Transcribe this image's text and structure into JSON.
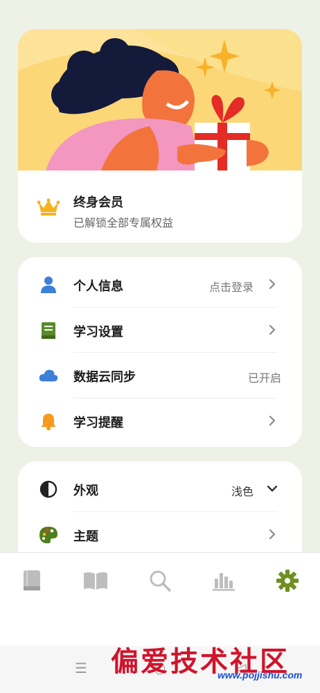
{
  "membership": {
    "title": "终身会员",
    "subtitle": "已解锁全部专属权益"
  },
  "settings": [
    {
      "label": "个人信息",
      "value": "点击登录",
      "icon": "person-icon",
      "chevron": true
    },
    {
      "label": "学习设置",
      "value": "",
      "icon": "book-icon",
      "chevron": true
    },
    {
      "label": "数据云同步",
      "value": "已开启",
      "icon": "cloud-icon",
      "chevron": false
    },
    {
      "label": "学习提醒",
      "value": "",
      "icon": "bell-icon",
      "chevron": true
    }
  ],
  "appearance": {
    "label": "外观",
    "value": "浅色",
    "theme_label": "主题"
  },
  "tabs": [
    "book-icon",
    "open-book-icon",
    "search-icon",
    "chart-icon",
    "gear-icon"
  ],
  "active_tab": "gear-icon",
  "colors": {
    "background": "#eef2e6",
    "accent_green": "#6f8f22",
    "blue": "#3d7fd9",
    "orange": "#f59a1b",
    "banner_yellow": "#fcd778"
  },
  "watermark": {
    "text": "偏爱技术社区",
    "url": "www.pojjishu.com"
  }
}
